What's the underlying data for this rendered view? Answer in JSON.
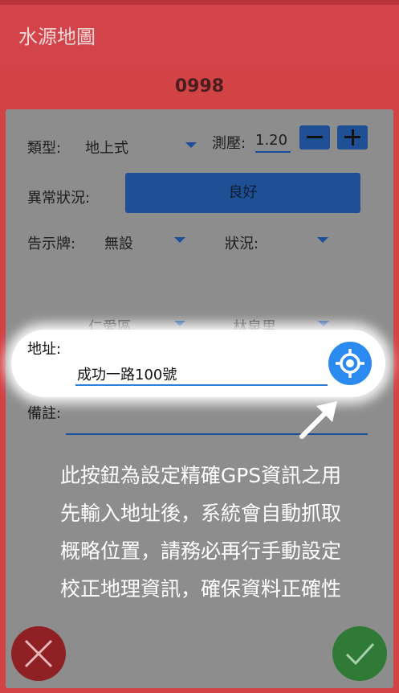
{
  "app": {
    "title": "水源地圖"
  },
  "station": {
    "id": "0998"
  },
  "form": {
    "type_label": "類型:",
    "type_value": "地上式",
    "pressure_label": "測壓:",
    "pressure_value": "1.20",
    "abnormal_label": "異常狀況:",
    "abnormal_value": "良好",
    "sign_label": "告示牌:",
    "sign_value": "無設",
    "condition_label": "狀況:",
    "condition_value": "",
    "district_value": "仁愛區",
    "village_value": "林泉里",
    "address_label": "地址:",
    "address_value": "成功一路100號",
    "note_label": "備註:",
    "note_value": ""
  },
  "hint": {
    "lines": [
      "此按鈕為設定精確GPS資訊之用",
      "先輸入地址後，系統會自動抓取",
      "概略位置，請務必再行手動設定",
      "校正地理資訊，確保資料正確性"
    ]
  },
  "icons": {
    "gps": "gps-target-icon",
    "cancel": "close-icon",
    "confirm": "check-icon",
    "minus": "minus-icon",
    "plus": "plus-icon",
    "arrow": "pointer-arrow-icon"
  },
  "colors": {
    "primary": "#d3434a",
    "accent_blue": "#1f4f95",
    "gps_blue": "#2b8af0",
    "cancel_red": "#8f2023",
    "confirm_green": "#2f7a37"
  }
}
